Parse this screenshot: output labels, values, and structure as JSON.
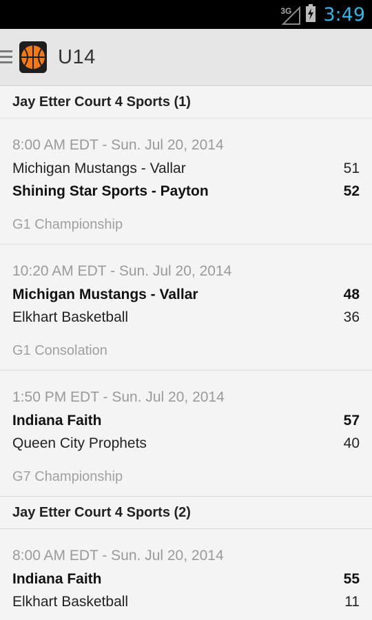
{
  "status_bar": {
    "network": "3G",
    "time": "3:49",
    "colors": {
      "time": "#33b5e5",
      "background": "#000000"
    }
  },
  "action_bar": {
    "title": "U14",
    "icons": [
      "menu-icon",
      "basketball-logo-icon"
    ]
  },
  "sections": [
    {
      "header": "Jay Etter Court 4 Sports (1)",
      "games": [
        {
          "time": "8:00 AM EDT - Sun. Jul 20, 2014",
          "team1": {
            "name": "Michigan Mustangs - Vallar",
            "score": "51"
          },
          "team2": {
            "name": "Shining Star Sports - Payton",
            "score": "52"
          },
          "label": "G1 Championship"
        },
        {
          "time": "10:20 AM EDT - Sun. Jul 20, 2014",
          "team1": {
            "name": "Michigan Mustangs - Vallar",
            "score": "48"
          },
          "team2": {
            "name": "Elkhart Basketball",
            "score": "36"
          },
          "label": "G1 Consolation"
        },
        {
          "time": "1:50 PM EDT - Sun. Jul 20, 2014",
          "team1": {
            "name": "Indiana Faith",
            "score": "57"
          },
          "team2": {
            "name": "Queen City Prophets",
            "score": "40"
          },
          "label": "G7 Championship"
        }
      ]
    },
    {
      "header": "Jay Etter Court 4 Sports (2)",
      "games": [
        {
          "time": "8:00 AM EDT - Sun. Jul 20, 2014",
          "team1": {
            "name": "Indiana Faith",
            "score": "55"
          },
          "team2": {
            "name": "Elkhart Basketball",
            "score": "11"
          }
        }
      ]
    }
  ]
}
